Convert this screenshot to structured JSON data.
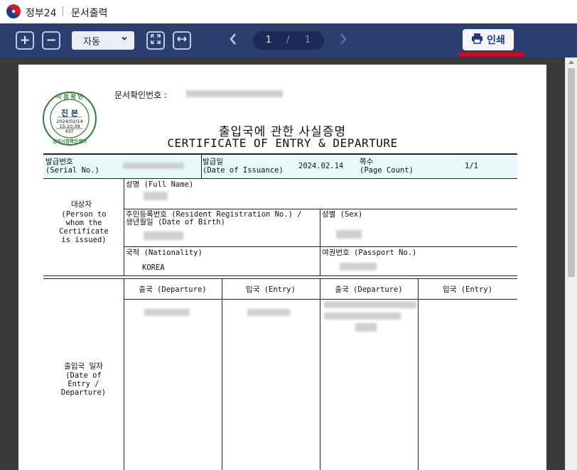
{
  "titlebar": {
    "app_name": "정부24",
    "separator": "|",
    "doc_title": "문서출력"
  },
  "toolbar": {
    "zoom_in_icon": "+",
    "zoom_out_icon": "−",
    "zoom_value": "자동",
    "fit_page_icon": "fit-page",
    "fit_width_icon": "fit-width",
    "page_current": "1",
    "page_separator": "/",
    "page_total": "1",
    "print_label": "인쇄",
    "accent_color": "#e60012",
    "toolbar_color": "#2b3f6e"
  },
  "seal": {
    "top_text": "시 점 확 인",
    "center_text": "진 본",
    "date": "2024/02/14",
    "time": "15:10:39",
    "tz": "KST",
    "bottom_text": "정부시점확인센터"
  },
  "document": {
    "doc_confirm_label": "문서확인번호 :",
    "title_kr": "출입국에 관한 사실증명",
    "title_en": "CERTIFICATE OF ENTRY & DEPARTURE",
    "serial_label_kr": "발급번호",
    "serial_label_en": "(Serial No.)",
    "issue_label_kr": "발급일",
    "issue_label_en": "(Date of Issuance)",
    "issue_date": "2024.02.14",
    "page_label_kr": "쪽수",
    "page_label_en": "(Page Count)",
    "page_count": "1/1",
    "subject_kr": "대상자",
    "subject_en": "(Person to whom the Certificate is issued)",
    "name_label": "성명 (Full Name)",
    "rrn_label_1": "주민등록번호 (Resident Registration No.) /",
    "rrn_label_2": "생년월일 (Date of Birth)",
    "sex_label": "성별 (Sex)",
    "nationality_label": "국적 (Nationality)",
    "nationality_value": "KOREA",
    "passport_label": "여권번호 (Passport No.)",
    "col_departure_1": "출국 (Departure)",
    "col_entry_1": "입국 (Entry)",
    "col_departure_2": "출국 (Departure)",
    "col_entry_2": "입국 (Entry)",
    "dates_kr": "출입국 일자",
    "dates_en": "(Date of Entry / Departure)"
  }
}
